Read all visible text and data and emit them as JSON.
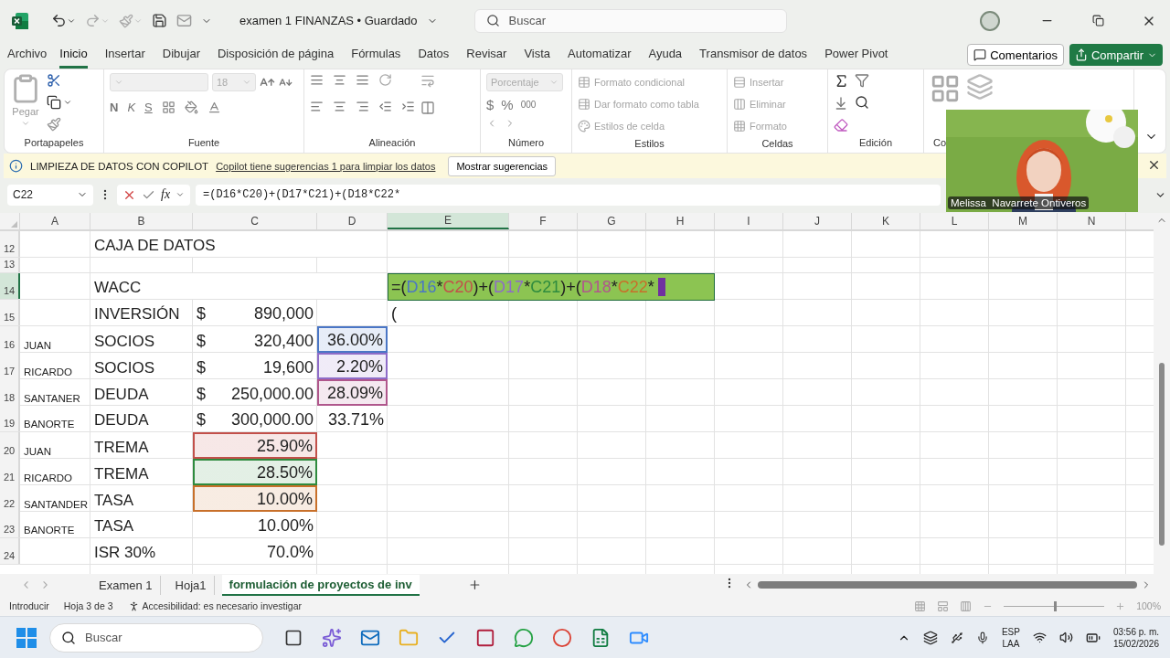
{
  "title_bar": {
    "document_title": "examen 1 FINANZAS • Guardado",
    "search_placeholder": "Buscar"
  },
  "menu_tabs": [
    {
      "label": "Archivo",
      "selected": false
    },
    {
      "label": "Inicio",
      "selected": true
    },
    {
      "label": "Insertar",
      "selected": false
    },
    {
      "label": "Dibujar",
      "selected": false
    },
    {
      "label": "Disposición de página",
      "selected": false
    },
    {
      "label": "Fórmulas",
      "selected": false
    },
    {
      "label": "Datos",
      "selected": false
    },
    {
      "label": "Revisar",
      "selected": false
    },
    {
      "label": "Vista",
      "selected": false
    },
    {
      "label": "Automatizar",
      "selected": false
    },
    {
      "label": "Ayuda",
      "selected": false
    },
    {
      "label": "Transmisor de datos",
      "selected": false
    },
    {
      "label": "Power Pivot",
      "selected": false
    }
  ],
  "comments_button": "Comentarios",
  "share_button": "Compartir",
  "ribbon": [
    {
      "kind": "clipboard",
      "label": "Portapapeles",
      "paste": "Pegar"
    },
    {
      "kind": "font",
      "label": "Fuente",
      "size": "18",
      "bold": "N",
      "italic": "K",
      "underline": "S"
    },
    {
      "kind": "alignment",
      "label": "Alineación"
    },
    {
      "kind": "number",
      "label": "Número",
      "format": "Porcentaje",
      "currency": "$",
      "percent": "%",
      "thousands": "000"
    },
    {
      "kind": "styles",
      "label": "Estilos",
      "items": [
        {
          "label": "Formato condicional",
          "disabled": true
        },
        {
          "label": "Dar formato como tabla",
          "disabled": true
        },
        {
          "label": "Estilos de celda",
          "disabled": true
        }
      ]
    },
    {
      "kind": "cells",
      "label": "Celdas",
      "items": [
        {
          "label": "Insertar",
          "disabled": true
        },
        {
          "label": "Eliminar",
          "disabled": true
        },
        {
          "label": "Formato",
          "disabled": true
        }
      ]
    },
    {
      "kind": "editing",
      "label": "Edición"
    },
    {
      "kind": "addins",
      "label": "Co"
    }
  ],
  "copilot_bar": {
    "title": "LIMPIEZA DE DATOS CON COPILOT",
    "link": "Copilot tiene sugerencias 1 para limpiar los datos",
    "button": "Mostrar sugerencias"
  },
  "formula_bar": {
    "name_box": "C22",
    "function_label": "fx",
    "formula": "=(D16*C20)+(D17*C21)+(D18*C22*"
  },
  "columns": [
    {
      "label": "A",
      "selected": false
    },
    {
      "label": "B",
      "selected": false
    },
    {
      "label": "C",
      "selected": false
    },
    {
      "label": "D",
      "selected": false
    },
    {
      "label": "E",
      "selected": true
    },
    {
      "label": "F",
      "selected": false
    },
    {
      "label": "G",
      "selected": false
    },
    {
      "label": "H",
      "selected": false
    },
    {
      "label": "I",
      "selected": false
    },
    {
      "label": "J",
      "selected": false
    },
    {
      "label": "K",
      "selected": false
    },
    {
      "label": "L",
      "selected": false
    },
    {
      "label": "M",
      "selected": false
    },
    {
      "label": "N",
      "selected": false
    }
  ],
  "rows": [
    {
      "number": "12",
      "selected": false,
      "b": "CAJA DE DATOS"
    },
    {
      "number": "13",
      "selected": false
    },
    {
      "number": "14",
      "selected": true,
      "b": "WACC",
      "e": {
        "kind": "editing",
        "segments": [
          {
            "text": "=(",
            "color": "#222222"
          },
          {
            "text": "D16",
            "color": "#4a76c5"
          },
          {
            "text": "*",
            "color": "#222222"
          },
          {
            "text": "C20",
            "color": "#c2504a"
          },
          {
            "text": ")+(",
            "color": "#222222"
          },
          {
            "text": "D17",
            "color": "#8e6cc8"
          },
          {
            "text": "*",
            "color": "#222222"
          },
          {
            "text": "C21",
            "color": "#2e8b3e"
          },
          {
            "text": ")+(",
            "color": "#222222"
          },
          {
            "text": "D18",
            "color": "#b0578c"
          },
          {
            "text": "*",
            "color": "#222222"
          },
          {
            "text": "C22",
            "color": "#c8702a"
          },
          {
            "text": "*",
            "color": "#222222"
          }
        ]
      }
    },
    {
      "number": "15",
      "selected": false,
      "b": "INVERSIÓN",
      "c": {
        "currency": "$",
        "value": "890,000"
      },
      "e": {
        "kind": "text",
        "value": "("
      }
    },
    {
      "number": "16",
      "selected": false,
      "a": "JUAN",
      "b": "SOCIOS",
      "c": {
        "currency": "$",
        "value": "320,400"
      },
      "d": {
        "value": "36.00%",
        "color": "#4a76c5"
      }
    },
    {
      "number": "17",
      "selected": false,
      "a": "RICARDO",
      "b": "SOCIOS",
      "c": {
        "currency": "$",
        "value": "19,600"
      },
      "d": {
        "value": "2.20%",
        "color": "#8e6cc8"
      }
    },
    {
      "number": "18",
      "selected": false,
      "a": "SANTANER",
      "b": "DEUDA",
      "c": {
        "currency": "$",
        "value": "250,000.00"
      },
      "d": {
        "value": "28.09%",
        "color": "#b0578c"
      }
    },
    {
      "number": "19",
      "selected": false,
      "a": "BANORTE",
      "b": "DEUDA",
      "c": {
        "currency": "$",
        "value": "300,000.00"
      },
      "d": {
        "value": "33.71%"
      }
    },
    {
      "number": "20",
      "selected": false,
      "a": "JUAN",
      "b": "TREMA",
      "c": {
        "value": "25.90%",
        "color": "#c2504a"
      }
    },
    {
      "number": "21",
      "selected": false,
      "a": "RICARDO",
      "b": "TREMA",
      "c": {
        "value": "28.50%",
        "color": "#2e8b3e"
      }
    },
    {
      "number": "22",
      "selected": false,
      "a": "SANTANDER",
      "b": "TASA",
      "c": {
        "value": "10.00%",
        "color": "#c8702a"
      }
    },
    {
      "number": "23",
      "selected": false,
      "a": "BANORTE",
      "b": "TASA",
      "c": {
        "value": "10.00%"
      }
    },
    {
      "number": "24",
      "selected": false,
      "b": "ISR 30%",
      "c": {
        "value": "70.0%"
      }
    }
  ],
  "sheet_tabs": [
    {
      "label": "Examen 1",
      "selected": false
    },
    {
      "label": "Hoja1",
      "selected": false
    },
    {
      "label": "formulación de proyectos de inv",
      "selected": true
    }
  ],
  "status_bar": {
    "mode": "Introducir",
    "sheet": "Hoja 3 de 3",
    "accessibility": "Accesibilidad: es necesario investigar",
    "zoom": "100%",
    "zoom_slider": {
      "level": 0.5
    }
  },
  "video": {
    "caption": "Melissa  Navarrete Ontiveros"
  },
  "taskbar": {
    "search_placeholder": "Buscar",
    "language": "ESP",
    "layout": "LAA",
    "time": "03:56 p. m.",
    "date": "15/02/2026"
  }
}
